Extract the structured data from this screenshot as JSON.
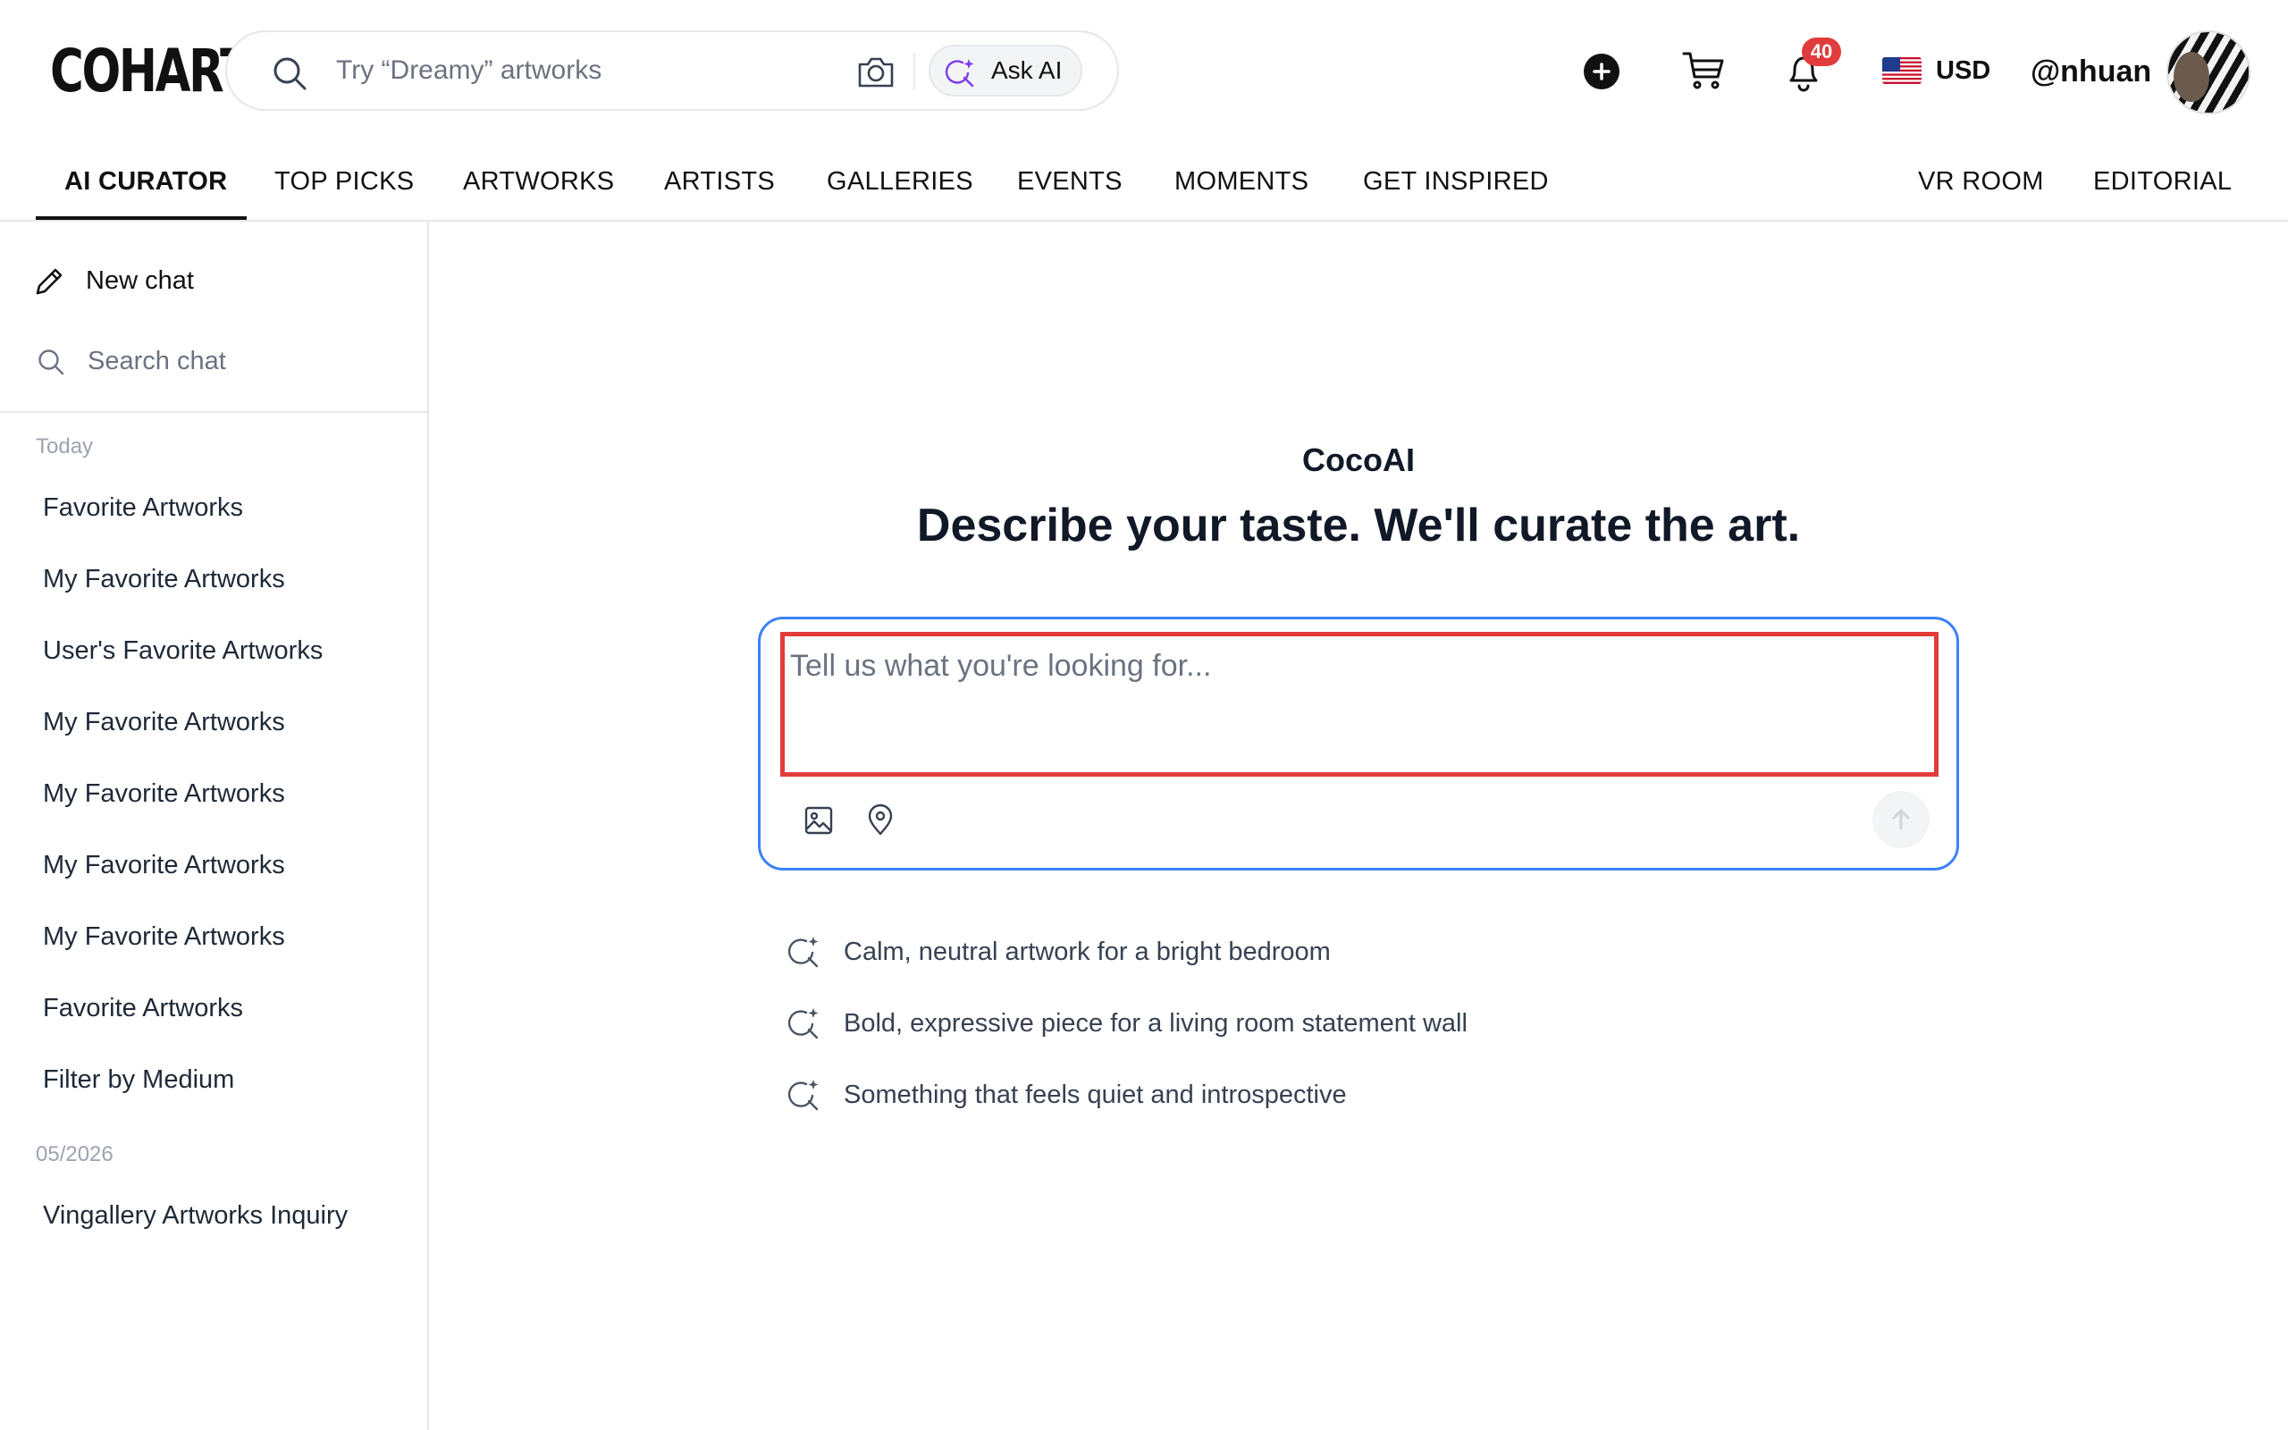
{
  "brand": {
    "logo": "COHART"
  },
  "search": {
    "placeholder": "Try “Dreamy” artworks",
    "ask_ai_label": "Ask AI"
  },
  "header": {
    "notifications_count": "40",
    "currency": "USD",
    "username": "@nhuan"
  },
  "nav": {
    "items": [
      "AI CURATOR",
      "TOP PICKS",
      "ARTWORKS",
      "ARTISTS",
      "GALLERIES",
      "EVENTS",
      "MOMENTS",
      "GET INSPIRED"
    ],
    "right_items": [
      "VR ROOM",
      "EDITORIAL"
    ],
    "active": "AI CURATOR"
  },
  "sidebar": {
    "new_chat_label": "New chat",
    "search_placeholder": "Search chat",
    "groups": [
      {
        "label": "Today",
        "items": [
          "Favorite Artworks",
          "My Favorite Artworks",
          "User's Favorite Artworks",
          "My Favorite Artworks",
          "My Favorite Artworks",
          "My Favorite Artworks",
          "My Favorite Artworks",
          "Favorite Artworks",
          "Filter by Medium"
        ]
      },
      {
        "label": "05/2026",
        "items": [
          "Vingallery Artworks Inquiry"
        ]
      }
    ]
  },
  "main": {
    "assistant_name": "CocoAI",
    "headline": "Describe your taste. We'll curate the art.",
    "prompt_placeholder": "Tell us what you're looking for...",
    "suggestions": [
      "Calm, neutral artwork for a bright bedroom",
      "Bold, expressive piece for a living room statement wall",
      "Something that feels quiet and introspective"
    ]
  },
  "colors": {
    "accent_blue": "#3b82f6",
    "highlight_red": "#e23b3b",
    "ai_purple": "#7c3aed",
    "text_dark": "#111827",
    "text_muted": "#6b7280"
  },
  "icons": {
    "search": "search-icon",
    "camera": "camera-icon",
    "ask_ai": "sparkle-search-icon",
    "add": "plus-circle-icon",
    "cart": "cart-icon",
    "bell": "bell-icon",
    "flag": "us-flag-icon",
    "pen": "pencil-icon",
    "image": "image-icon",
    "location": "location-pin-icon",
    "send": "arrow-up-icon"
  }
}
